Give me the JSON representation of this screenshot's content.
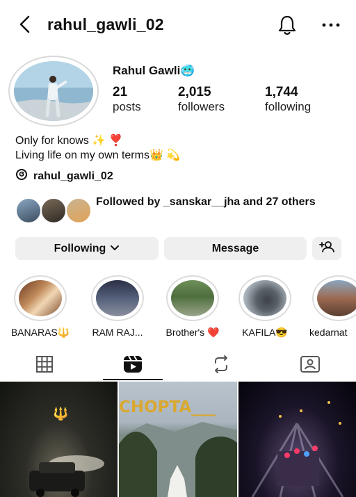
{
  "header": {
    "username": "rahul_gawli_02",
    "icons": [
      "back-arrow-icon",
      "bell-icon",
      "more-icon"
    ]
  },
  "profile": {
    "name": "Rahul Gawli",
    "name_emoji": "🥶",
    "stats": [
      {
        "value": "21",
        "label": "posts"
      },
      {
        "value": "2,015",
        "label": "followers"
      },
      {
        "value": "1,744",
        "label": "following"
      }
    ],
    "bio": [
      "Only for knows ✨ ❣️",
      "Living life on my own terms👑 💫"
    ],
    "threads_handle": "rahul_gawli_02",
    "followed_by": {
      "prefix": "Followed by ",
      "user": "_sanskar__jha",
      "suffix": " and 27 others"
    }
  },
  "actions": {
    "following": "Following",
    "message": "Message"
  },
  "highlights": [
    {
      "label": "BANARAS🔱"
    },
    {
      "label": "RAM RAJ..."
    },
    {
      "label": "Brother's ❤️"
    },
    {
      "label": "KAFILA😎"
    },
    {
      "label": "kedarnat"
    }
  ],
  "tabs": [
    "grid-icon",
    "reels-icon",
    "reposts-icon",
    "tagged-icon"
  ],
  "posts": [
    {
      "overlay": "🔱"
    },
    {
      "overlay": "CHOPTA___"
    },
    {
      "overlay": ""
    }
  ],
  "colors": {
    "button_bg": "#efefef",
    "text": "#111111",
    "ring": "#d9d9d9"
  }
}
